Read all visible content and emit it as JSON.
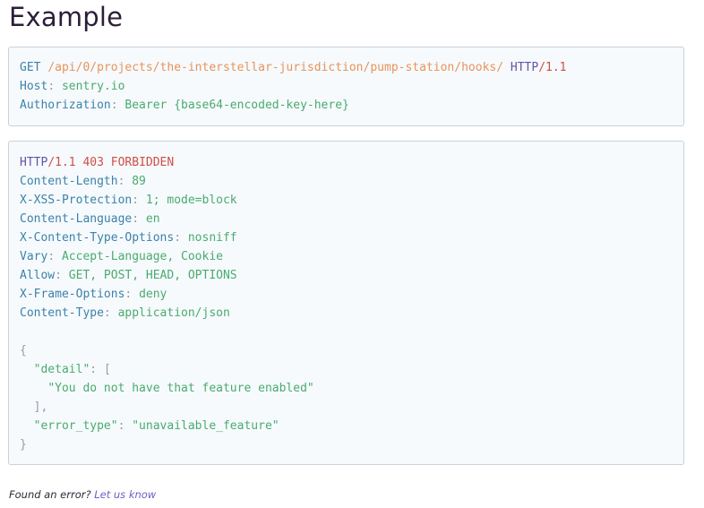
{
  "page_title": "Example",
  "request": {
    "method": "GET",
    "path": "/api/0/projects/the-interstellar-jurisdiction/pump-station/hooks/",
    "protocol": "HTTP",
    "version": "/1.1",
    "headers": [
      {
        "key": "Host",
        "value": "sentry.io"
      },
      {
        "key": "Authorization",
        "value": "Bearer {base64-encoded-key-here}"
      }
    ]
  },
  "response": {
    "protocol": "HTTP",
    "version": "/1.1",
    "status": "403 FORBIDDEN",
    "headers": [
      {
        "key": "Content-Length",
        "value": "89"
      },
      {
        "key": "X-XSS-Protection",
        "value": "1; mode=block"
      },
      {
        "key": "Content-Language",
        "value": "en"
      },
      {
        "key": "X-Content-Type-Options",
        "value": "nosniff"
      },
      {
        "key": "Vary",
        "value": "Accept-Language, Cookie"
      },
      {
        "key": "Allow",
        "value": "GET, POST, HEAD, OPTIONS"
      },
      {
        "key": "X-Frame-Options",
        "value": "deny"
      },
      {
        "key": "Content-Type",
        "value": "application/json"
      }
    ],
    "body": {
      "open_brace": "{",
      "detail_key": "\"detail\"",
      "detail_open": "[",
      "detail_item": "\"You do not have that feature enabled\"",
      "detail_close": "],",
      "error_type_key": "\"error_type\"",
      "error_type_value": "\"unavailable_feature\"",
      "close_brace": "}"
    }
  },
  "footer": {
    "text": "Found an error?",
    "link_label": "Let us know"
  }
}
